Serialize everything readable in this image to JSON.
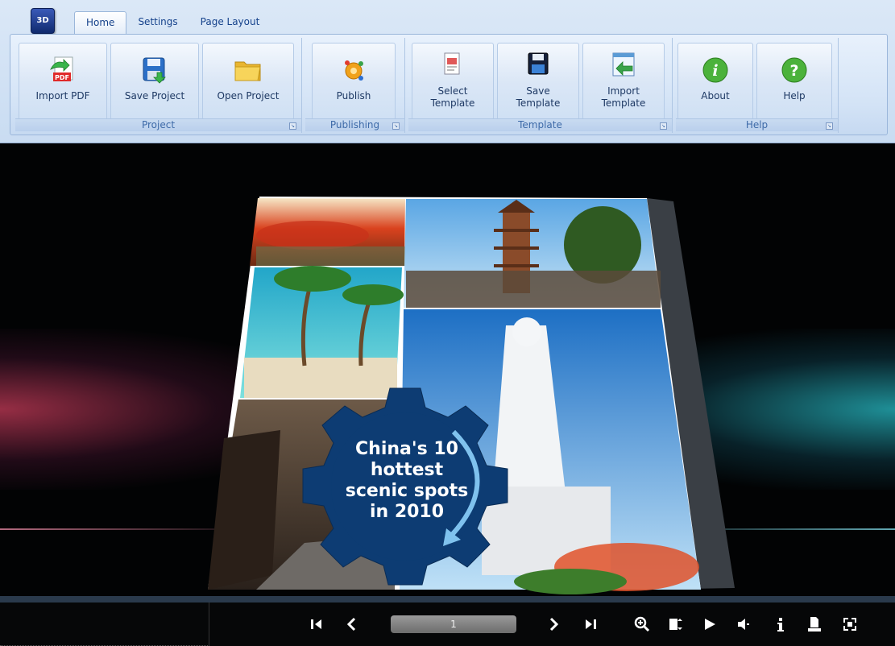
{
  "app": {
    "logo_text": "3D"
  },
  "tabs": [
    {
      "label": "Home"
    },
    {
      "label": "Settings"
    },
    {
      "label": "Page Layout"
    }
  ],
  "groups": {
    "project": {
      "label": "Project",
      "buttons": [
        {
          "label": "Import PDF"
        },
        {
          "label": "Save Project"
        },
        {
          "label": "Open Project"
        }
      ]
    },
    "publishing": {
      "label": "Publishing",
      "buttons": [
        {
          "label": "Publish"
        }
      ]
    },
    "template": {
      "label": "Template",
      "buttons": [
        {
          "line1": "Select",
          "line2": "Template"
        },
        {
          "line1": "Save",
          "line2": "Template"
        },
        {
          "line1": "Import",
          "line2": "Template"
        }
      ]
    },
    "help": {
      "label": "Help",
      "buttons": [
        {
          "label": "About"
        },
        {
          "label": "Help"
        }
      ]
    }
  },
  "book": {
    "cover_title": [
      "China's 10",
      "hottest",
      "scenic spots",
      "in 2010"
    ]
  },
  "toolbar": {
    "page_number": "1",
    "first_icon": "first-page-icon",
    "prev_icon": "previous-page-icon",
    "next_icon": "next-page-icon",
    "last_icon": "last-page-icon"
  },
  "colors": {
    "cover_gear": "#0d3c73",
    "cover_arrow": "#7fc2ee"
  }
}
